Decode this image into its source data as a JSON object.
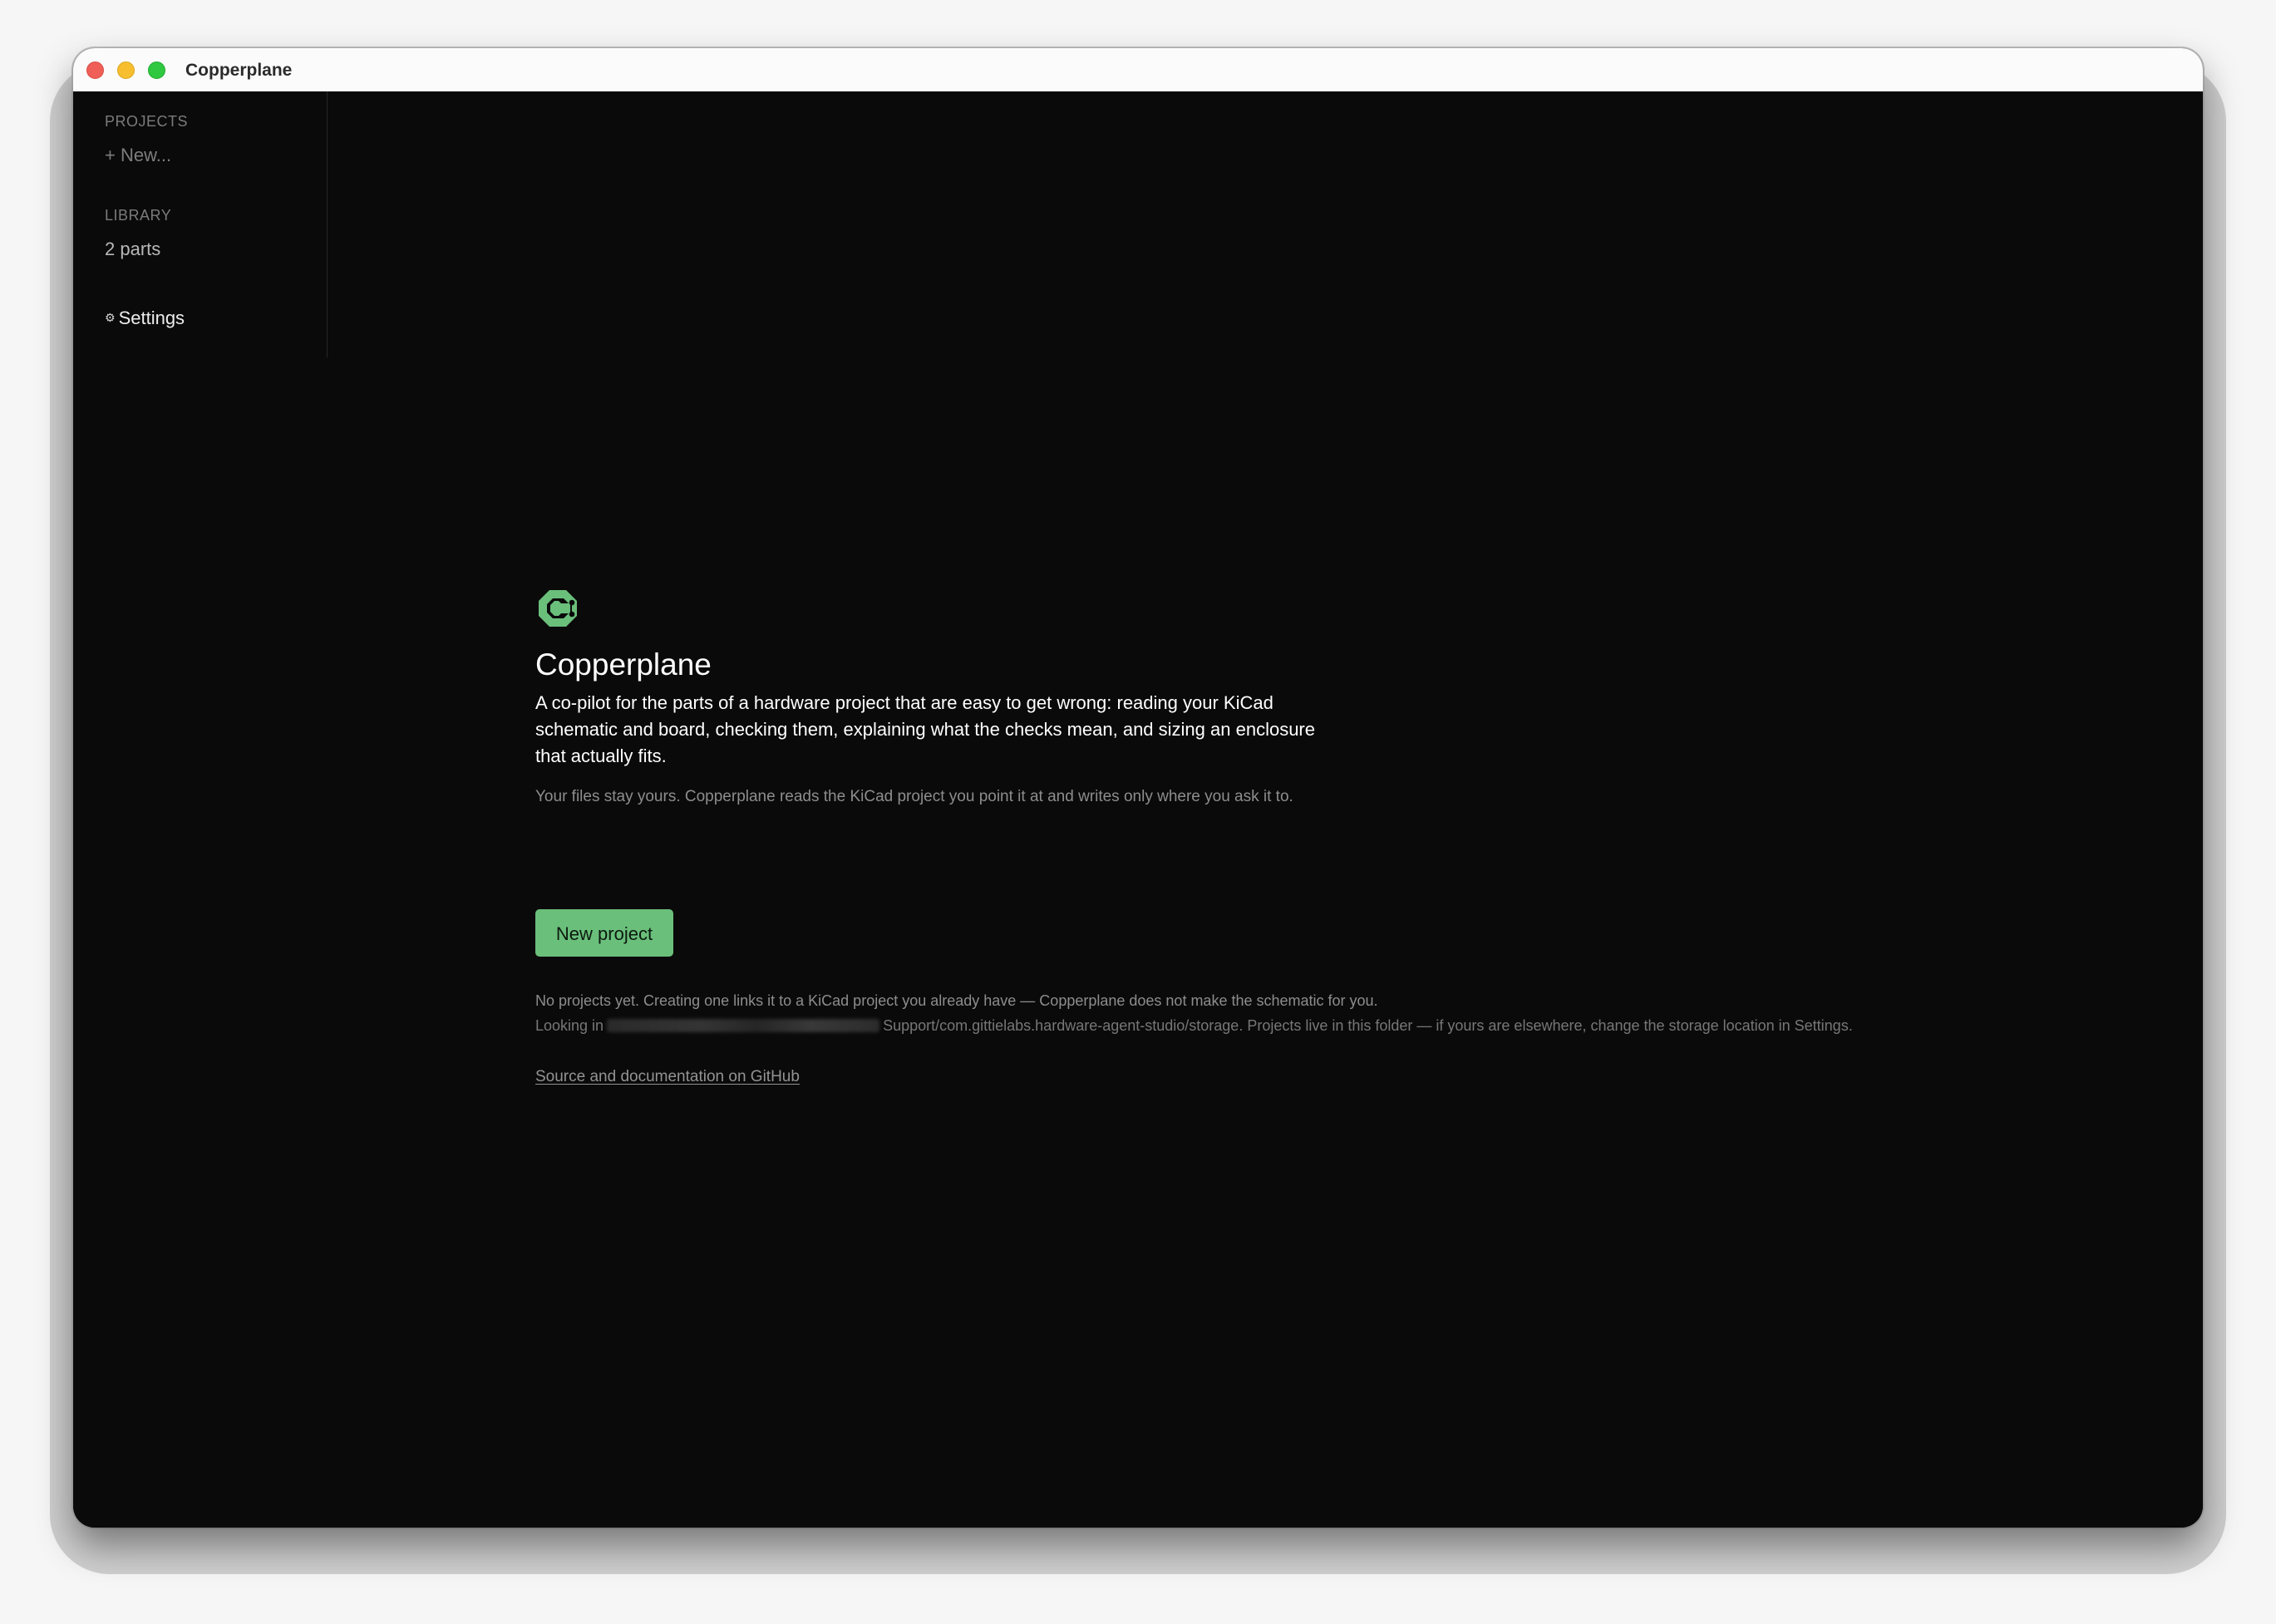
{
  "window": {
    "title": "Copperplane"
  },
  "sidebar": {
    "projects_label": "PROJECTS",
    "new_label": "+ New...",
    "library_label": "LIBRARY",
    "library_count": "2 parts",
    "settings_label": "Settings"
  },
  "main": {
    "app_name": "Copperplane",
    "description": "A co-pilot for the parts of a hardware project that are easy to get wrong: reading your KiCad schematic and board, checking them, explaining what the checks mean, and sizing an enclosure that actually fits.",
    "privacy": "Your files stay yours. Copperplane reads the KiCad project you point it at and writes only where you ask it to.",
    "new_project_button": "New project",
    "empty_note": "No projects yet. Creating one links it to a KiCad project you already have — Copperplane does not make the schematic for you.",
    "path_prefix": "Looking in",
    "path_suffix": "Support/com.gittielabs.hardware-agent-studio/storage. Projects live in this folder — if yours are elsewhere, change the storage location in Settings.",
    "github_link": "Source and documentation on GitHub"
  },
  "icons": {
    "logo": "copperplane-logo-icon",
    "settings": "gear-icon"
  },
  "colors": {
    "accent": "#6abf7b",
    "background": "#0a0a0a",
    "muted_text": "#8d8d8d"
  }
}
